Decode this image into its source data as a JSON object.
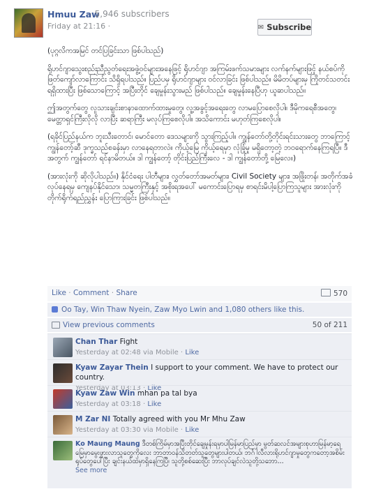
{
  "header": {
    "page_name": "Hmuu Zaw",
    "subscribers": "· 5,946 subscribers",
    "timestamp": "Friday at 21:16 ·",
    "subscribe_button": "Subscribe"
  },
  "post": {
    "paragraphs": [
      "(ပုဂ္ဂလိကအမြင် တင်ပြခြင်းသာ ဖြစ်ပါသည်)",
      "ရိုဟင်ဂျာသွေးစည်းညီညွတ်ရေးအဖွဲ့ဝင်များအနေဖြင့် ရိုဟင်ဂျာ အကြမ်းဖက်သမားများ လက်နက်များဖြင့် နယ်စပ်ကို ဖြတ်ကျော်လာကြောင်း သိရှိရပါသည်။ ပြည်ပမှ ရိုဟင်ဂျာများ ဝင်လာခြင်း ဖြစ်ပါသည်။ မိမိတပ်များမှ ကြိုတင်သတင်း ရရှိထားပြီး ဖြစ်သောကြောင့် အပြီးတိုင် ချေမှုန်းသွားမည် ဖြစ်ပါသည်။ ချေမှုန်းနေပြီဟု ယူဆပါသည်။",
      "ဤအတွက်တွေ လူသားချင်းစာနာထောက်ထားမှုတွေ၊ လူ့အခွင့်အရေးတွေ လာမပြောစေလိုပါ။ ဒီမိုကရေစီအတွေ၊ မေတ္တာရှင်ကြီးလိုလို လာပြီး ဆရာကြီး မလုပ်ကြစေလိုပါ။ အသိကောင်း မဟုတ်ကြစေလိုပါ။",
      "(ရခိုင်ပြည်နယ်က ဘူးသီးတောင်၊ မောင်တော ဒေသများကို သွားကြည့်ပါ။ ကျွန်တော်တို့တိုင်းရင်းသားတွေ ဘာကြောင့် ကျွန်တော့်ဆီ ဒုက္ခသည်စခန်းမှာ လာနေရတာလဲ။ ကိုယ့်မြေ ကိုယ့်ရေမှာ လုံခြုံမှု မရှိတော့တဲ့ ဘဝရောက်နေကြရပြီ။ ဒီအတွက် ကျွန်တော် ရင်နာမိတယ်။ ဒါ ကျွန်တော့် တိုင်းပြည်ကြီးလေ - ဒါ ကျွန်တော်တို့ မြေလေ။)",
      "(အားလုံးကို ဆိုလိုပါသည်။) နိုင်ငံရေး ပါတီများ၊ လွှတ်တော်အမတ်များ၊ Civil Society များ၊ အဖြိုးတန်၊ အတိုက်အခံလုပ်နေရမှ ကျေနပ်နိုင်သော၊ သမ္မတကြီးနှင့် အစိုးရအပေါ် မကောင်းပြောရမှ စာရင်းမိပါ့ပြောကြသူများ အားလုံးကို တိုက်ရိုက်ရည်ညွှန်း ပြောကြားခြင်း ဖြစ်ပါသည်။"
    ]
  },
  "actions": {
    "like": "Like",
    "comment": "Comment",
    "share": "Share",
    "sep": "·",
    "share_count": "570"
  },
  "likes": {
    "text": "Oo Tay, Win Thaw Nyein, Zaw Myo Lwin and 1,080 others like this."
  },
  "previous": {
    "label": "View previous comments",
    "count": "50 of 211"
  },
  "comments": [
    {
      "name": "Chan Thar",
      "text": "Fight",
      "meta": "Yesterday at 02:48 via Mobile ·",
      "like": "Like"
    },
    {
      "name": "Kyaw Zayar Thein",
      "text": "I support to your comment. We have to protect our country.",
      "meta": "Yesterday at 03:13 ·",
      "like": "Like"
    },
    {
      "name": "Kyaw Zaw Win",
      "text": "mhan pa tal bya",
      "meta": "Yesterday at 03:18 ·",
      "like": "Like"
    },
    {
      "name": "M Zar NI",
      "text": "Totally agreed with you Mr Mhu Zaw",
      "meta": "Yesterday at 03:30 via Mobile ·",
      "like": "Like"
    },
    {
      "name": "Ko Maung Maung",
      "text": "ဒီတစ်ကြိမ်မှာအပြီးတိုင်ချေမှုန်းရမှာပါမြန်မာပြည်မှာ မွတ်ဆလင်အများစုဟာမြန်မာ့ရေမြေမှာမွေးဖွားလာသူတွေကိုလေး ဘာတာဝန်သိတတ်သူတွေများပါတယ်၊ ဘင်္ဂါလီလားရိုဟင်ဂျာမှုတွေကတော့အစိမ်းရုပ်တွေပေါ်ပြီး ချင်းနယ်ထဲမှာရှိနေကြပြီ၊ သူတို့စစ်ဆေးပြီး ဘာလုပ်ချင်လဲသူတို့သဘော...",
      "meta": "",
      "like": "",
      "see_more": "See more"
    }
  ]
}
